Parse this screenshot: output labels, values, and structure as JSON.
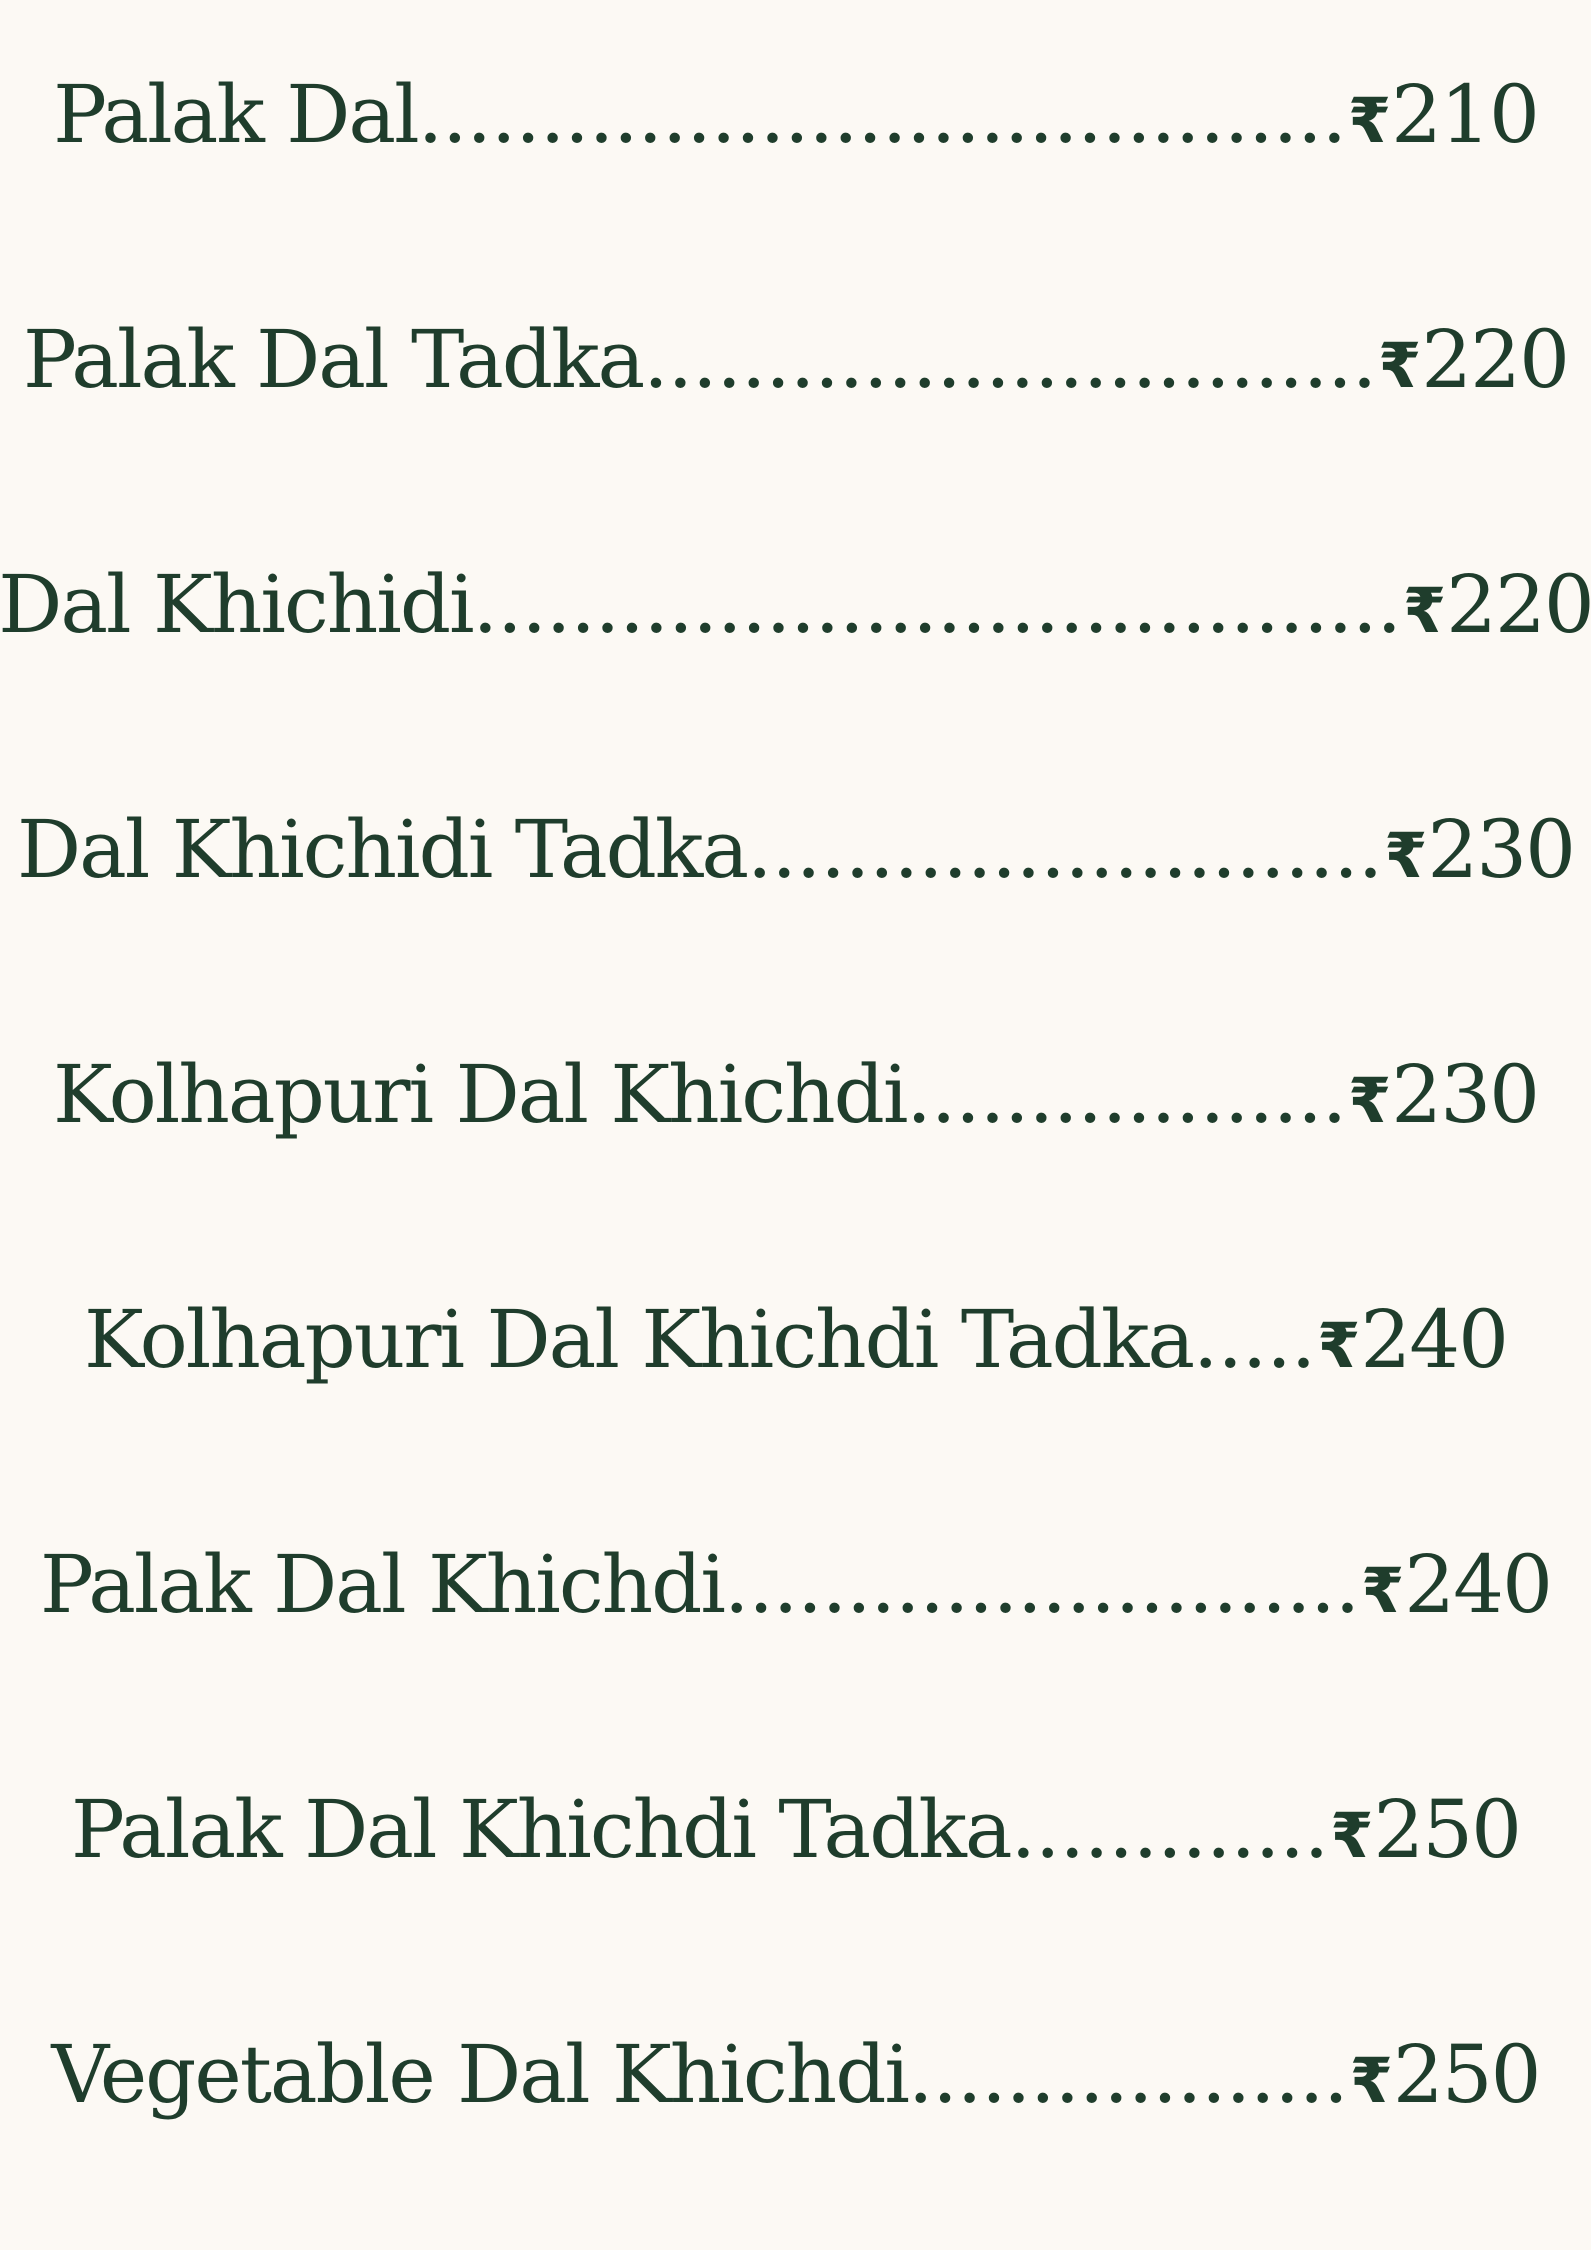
{
  "menu": {
    "currency_symbol": "₹",
    "items": [
      {
        "name": "Palak Dal",
        "leader": "......................................",
        "price": "210"
      },
      {
        "name": "Palak Dal Tadka",
        "leader": "..............................",
        "price": "220"
      },
      {
        "name": "Dal Khichidi",
        "leader": "......................................",
        "price": "220"
      },
      {
        "name": "Dal Khichidi Tadka",
        "leader": "..........................",
        "price": "230"
      },
      {
        "name": "Kolhapuri Dal Khichdi",
        "leader": "..................",
        "price": "230"
      },
      {
        "name": "Kolhapuri Dal Khichdi Tadka",
        "leader": ".....",
        "price": "240"
      },
      {
        "name": "Palak Dal Khichdi",
        "leader": "..........................",
        "price": "240"
      },
      {
        "name": "Palak Dal Khichdi Tadka",
        "leader": ".............",
        "price": "250"
      },
      {
        "name": "Vegetable Dal Khichdi",
        "leader": "..................",
        "price": "250"
      }
    ]
  },
  "colors": {
    "background": "#fcf9f4",
    "text": "#1f3d2c"
  }
}
